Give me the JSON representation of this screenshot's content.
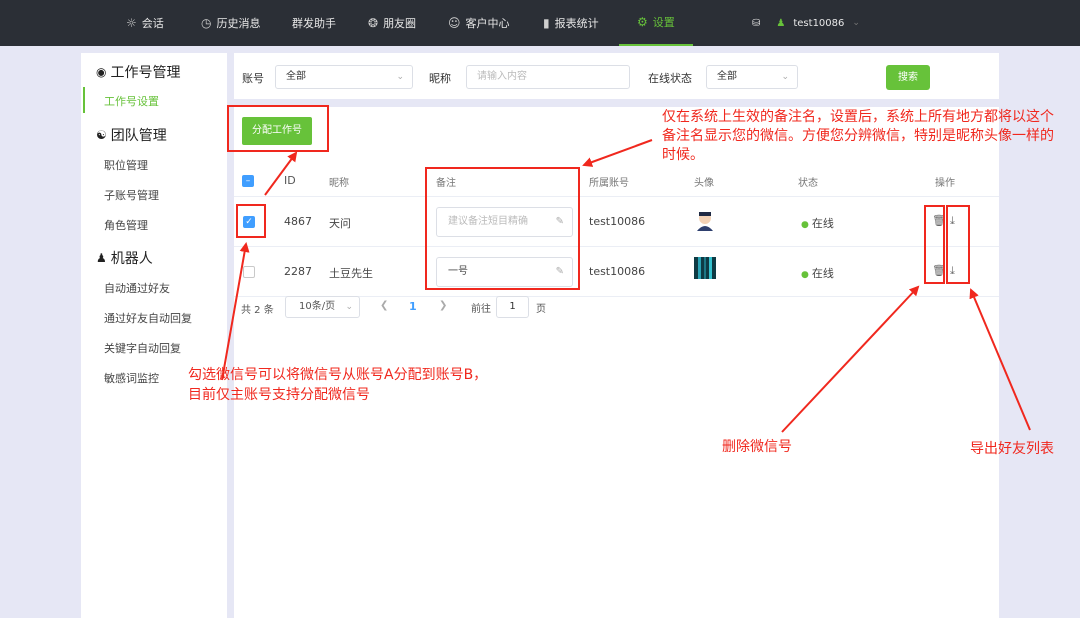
{
  "nav": {
    "items": [
      {
        "label": "会话",
        "icon": "chat-icon"
      },
      {
        "label": "历史消息",
        "icon": "clock-icon"
      },
      {
        "label": "群发助手",
        "icon": ""
      },
      {
        "label": "朋友圈",
        "icon": "aperture-icon"
      },
      {
        "label": "客户中心",
        "icon": "person-icon"
      },
      {
        "label": "报表统计",
        "icon": "bar-chart-icon"
      },
      {
        "label": "设置",
        "icon": "gear-icon"
      }
    ],
    "active_index": 6,
    "username": "test10086"
  },
  "sidebar": {
    "groups": [
      {
        "label": "工作号管理",
        "items": [
          "工作号设置"
        ]
      },
      {
        "label": "团队管理",
        "items": [
          "职位管理",
          "子账号管理",
          "角色管理"
        ]
      },
      {
        "label": "机器人",
        "items": [
          "自动通过好友",
          "通过好友自动回复",
          "关键字自动回复",
          "敏感词监控"
        ]
      }
    ]
  },
  "filters": {
    "account_label": "账号",
    "account_value": "全部",
    "nickname_label": "昵称",
    "nickname_placeholder": "请输入内容",
    "status_label": "在线状态",
    "status_value": "全部",
    "search_button": "搜索"
  },
  "assign_button": "分配工作号",
  "table": {
    "columns": [
      "ID",
      "昵称",
      "备注",
      "所属账号",
      "头像",
      "状态",
      "操作"
    ],
    "rows": [
      {
        "id": "4867",
        "nickname": "天问",
        "note": "",
        "note_placeholder": "建议备注短目精确",
        "account": "test10086",
        "status": "在线",
        "checked": true
      },
      {
        "id": "2287",
        "nickname": "土豆先生",
        "note": "一号",
        "note_placeholder": "",
        "account": "test10086",
        "status": "在线",
        "checked": false
      }
    ]
  },
  "pagination": {
    "total": "共 2 条",
    "page_size": "10条/页",
    "current": "1",
    "goto_label": "前往",
    "goto_value": "1",
    "page_suffix": "页"
  },
  "annotations": {
    "note_explain": "仅在系统上生效的备注名，设置后，系统上所有地方都将以这个备注名显示您的微信。方便您分辨微信，特别是昵称头像一样的时候。",
    "checkbox_explain_1": "勾选微信号可以将微信号从账号A分配到账号B，",
    "checkbox_explain_2": "目前仅主账号支持分配微信号",
    "delete_label": "删除微信号",
    "export_label": "导出好友列表"
  },
  "colors": {
    "accent": "#67c23a",
    "annotation": "#f0281e",
    "topbar": "#2b2f36"
  }
}
